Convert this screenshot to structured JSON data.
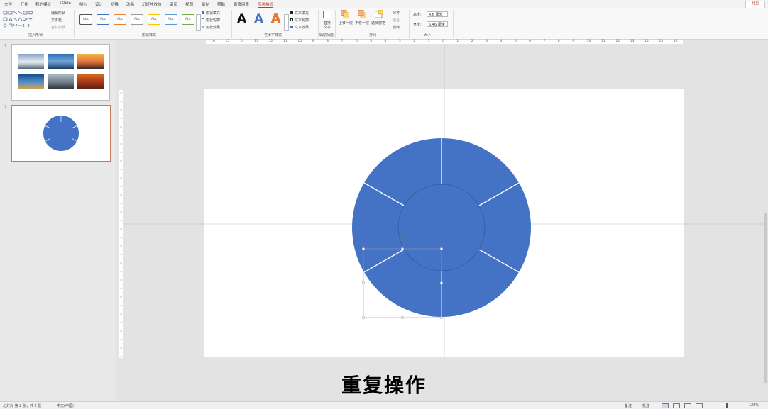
{
  "menu": {
    "tabs": [
      "文件",
      "开始",
      "我的模板",
      "iSlide",
      "插入",
      "设计",
      "切换",
      "动画",
      "幻灯片放映",
      "审阅",
      "视图",
      "录制",
      "帮助",
      "百度网盘",
      "形状格式"
    ],
    "active_tab": "形状格式",
    "share_label": "共享"
  },
  "ribbon": {
    "insert_shapes": {
      "edit_shape": "编辑形状",
      "text_box": "文本框",
      "merge_shapes": "合并形状",
      "group_label": "插入形状"
    },
    "shape_styles": {
      "style_label": "Abc",
      "fill": "形状填充",
      "outline": "形状轮廓",
      "effects": "形状效果",
      "group_label": "形状样式"
    },
    "wordart": {
      "letter": "A",
      "text_fill": "文本填充",
      "text_outline": "文本轮廓",
      "text_effects": "文本效果",
      "group_label": "艺术字样式"
    },
    "accessibility": {
      "alt_text": "替换文字",
      "group_label": "辅助功能"
    },
    "arrange": {
      "bring_forward": "上移一层",
      "send_backward": "下移一层",
      "selection_pane": "选择窗格",
      "align": "对齐",
      "group": "组合",
      "rotate": "旋转",
      "group_label": "排列"
    },
    "size": {
      "height_label": "高度:",
      "height_value": "4.6 厘米",
      "width_label": "宽度:",
      "width_value": "5.46 厘米",
      "group_label": "大小"
    }
  },
  "slides": {
    "numbers": [
      "1",
      "2"
    ]
  },
  "ruler": {
    "labels": [
      "16",
      "15",
      "14",
      "13",
      "12",
      "11",
      "10",
      "9",
      "8",
      "7",
      "6",
      "5",
      "4",
      "3",
      "2",
      "1",
      "0",
      "1",
      "2",
      "3",
      "4",
      "5",
      "6",
      "7",
      "8",
      "9",
      "10",
      "11",
      "12",
      "13",
      "14",
      "15",
      "16"
    ]
  },
  "subtitle": "重复操作",
  "status": {
    "slide_info": "幻灯片 第 2 张，共 2 张",
    "language": "中文(中国)",
    "notes": "备注",
    "comments": "批注",
    "zoom": "125%"
  },
  "colors": {
    "accent": "#c43e1c",
    "shape_blue": "#4472c4"
  }
}
